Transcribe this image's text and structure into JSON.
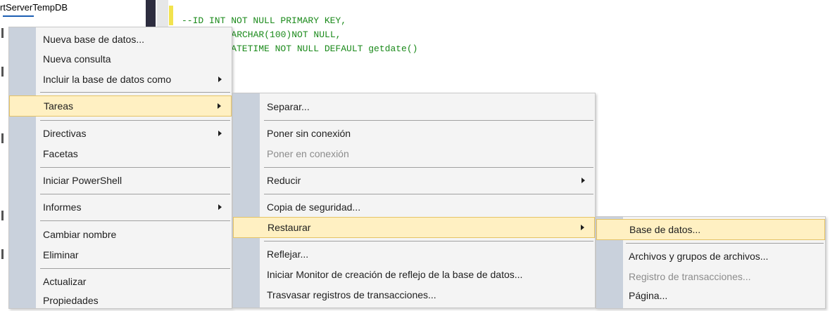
{
  "explorer": {
    "node_label": "rtServerTempDB"
  },
  "editor": {
    "lines": [
      "`",
      "--ID INT NOT NULL PRIMARY KEY,",
      "   ARCHAR(100)NOT NULL,",
      "    ATETIME NOT NULL DEFAULT getdate()"
    ]
  },
  "menu_main": {
    "items": [
      {
        "label": "Nueva base de datos..."
      },
      {
        "label": "Nueva consulta"
      },
      {
        "label": "Incluir la base de datos como"
      },
      {
        "label": "Tareas"
      },
      {
        "label": "Directivas"
      },
      {
        "label": "Facetas"
      },
      {
        "label": "Iniciar PowerShell"
      },
      {
        "label": "Informes"
      },
      {
        "label": "Cambiar nombre"
      },
      {
        "label": "Eliminar"
      },
      {
        "label": "Actualizar"
      },
      {
        "label": "Propiedades"
      }
    ]
  },
  "menu_tareas": {
    "items": [
      {
        "label": "Separar..."
      },
      {
        "label": "Poner sin conexión"
      },
      {
        "label": "Poner en conexión"
      },
      {
        "label": "Reducir"
      },
      {
        "label": "Copia de seguridad..."
      },
      {
        "label": "Restaurar"
      },
      {
        "label": "Reflejar..."
      },
      {
        "label": "Iniciar Monitor de creación de reflejo de la base de datos..."
      },
      {
        "label": "Trasvasar registros de transacciones..."
      }
    ]
  },
  "menu_restaurar": {
    "items": [
      {
        "label": "Base de datos..."
      },
      {
        "label": "Archivos y grupos de archivos..."
      },
      {
        "label": "Registro de transacciones..."
      },
      {
        "label": "Página..."
      }
    ]
  },
  "colors": {
    "highlight": "#fff0c2",
    "highlight_border": "#e5c365",
    "gutter": "#c9d1dc",
    "code_green": "#1b8a1b"
  }
}
